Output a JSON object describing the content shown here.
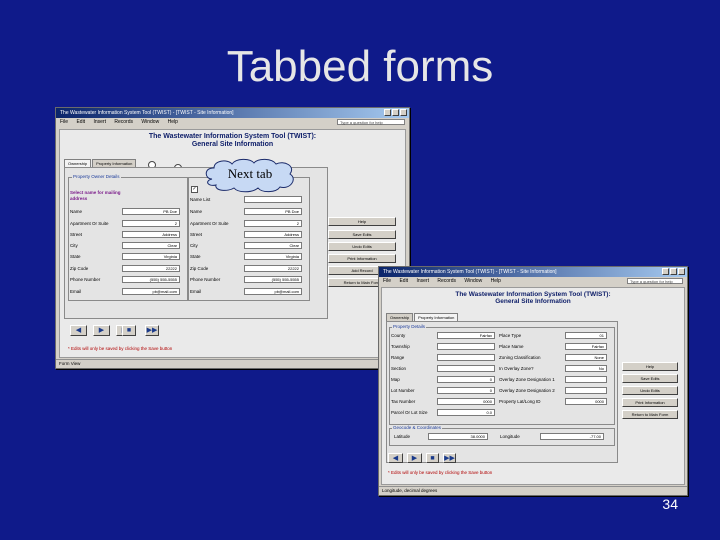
{
  "slide": {
    "title": "Tabbed forms",
    "page_number": "34"
  },
  "app": {
    "window_title": "The Wastewater Information System Tool (TWIST) - [TWIST - Site Information]",
    "menu": [
      "File",
      "Edit",
      "Insert",
      "Records",
      "Window",
      "Help"
    ],
    "help_placeholder": "Type a question for help",
    "form_title_line1": "The Wastewater Information System Tool (TWIST):",
    "form_title_line2": "General Site Information",
    "status": "Form View",
    "note": "* Edits will only be saved by clicking the Save button"
  },
  "window1": {
    "tabs": [
      "Ownership",
      "Property Information"
    ],
    "owner_group": "Property Owner Details",
    "owner_select_label": "Select name for mailing address",
    "owner_rows": [
      {
        "label": "Name",
        "value": "PB Doe"
      },
      {
        "label": "Apartment Or Suite",
        "value": "2"
      },
      {
        "label": "Street",
        "value": "Address"
      },
      {
        "label": "City",
        "value": "Clear"
      },
      {
        "label": "State",
        "value": "Virginia"
      },
      {
        "label": "Zip Code",
        "value": "22222"
      },
      {
        "label": "Phone Number",
        "value": "(555) 555-5555"
      },
      {
        "label": "Email",
        "value": "pb@mail.com"
      }
    ],
    "site_rows": [
      {
        "label": "Name List",
        "value": ""
      },
      {
        "label": "Name",
        "value": "PB Doe"
      },
      {
        "label": "Apartment Or Suite",
        "value": "2"
      },
      {
        "label": "Street",
        "value": "Address"
      },
      {
        "label": "City",
        "value": "Clear"
      },
      {
        "label": "State",
        "value": "Virginia"
      },
      {
        "label": "Zip Code",
        "value": "22222"
      },
      {
        "label": "Phone Number",
        "value": "(555) 555-5555"
      },
      {
        "label": "Email",
        "value": "pb@mail.com"
      }
    ],
    "side_buttons": [
      "Help",
      "Save Edits",
      "Undo Edits",
      "Print Information",
      "Add Record",
      "Return to Main Form"
    ]
  },
  "callout": {
    "text": "Next tab"
  },
  "window2": {
    "tabs": [
      "Ownership",
      "Property Information"
    ],
    "group": "Property Details",
    "left_rows": [
      {
        "label": "County",
        "value": "Fairfax"
      },
      {
        "label": "Township",
        "value": ""
      },
      {
        "label": "Range",
        "value": ""
      },
      {
        "label": "Section",
        "value": ""
      },
      {
        "label": "Map",
        "value": "0"
      },
      {
        "label": "Lot Number",
        "value": "0"
      },
      {
        "label": "Tax Number",
        "value": "0000"
      },
      {
        "label": "Parcel Or Lot Size",
        "value": "0.0"
      }
    ],
    "right_rows": [
      {
        "label": "Place Type",
        "value": "01"
      },
      {
        "label": "Place Name",
        "value": "Fairfax"
      },
      {
        "label": "Zoning Classification",
        "value": "None"
      },
      {
        "label": "In Overlay Zone?",
        "value": "No"
      },
      {
        "label": "Overlay Zone Designation 1",
        "value": ""
      },
      {
        "label": "Overlay Zone Designation 2",
        "value": ""
      },
      {
        "label": "Property Lat/Long ID",
        "value": "0000"
      }
    ],
    "geo_group": "Geocode & Coordinates",
    "latitude_label": "Latitude",
    "latitude_value": "38.0000",
    "longitude_label": "Longitude",
    "longitude_value": "-77.00",
    "side_buttons": [
      "Help",
      "Save Edits",
      "Undo Edits",
      "Print Information",
      "Return to Main Form"
    ],
    "status": "Longitude, decimal degrees"
  }
}
